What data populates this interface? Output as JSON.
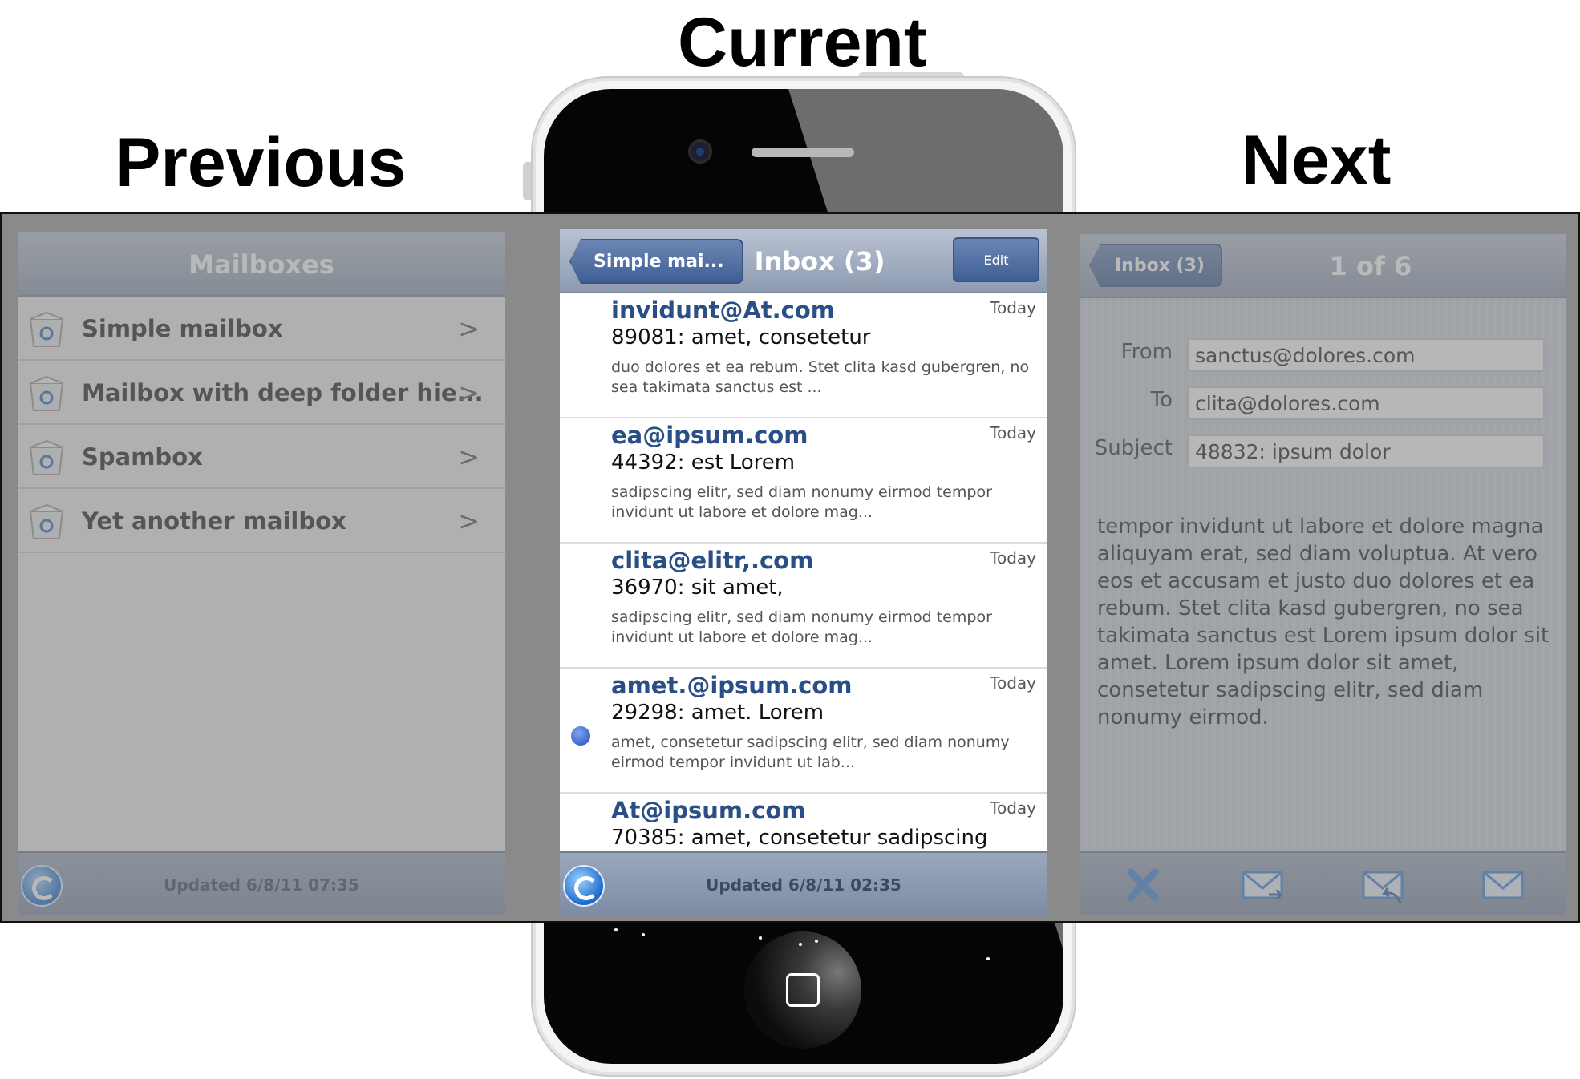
{
  "labels": {
    "current": "Current",
    "previous": "Previous",
    "next": "Next"
  },
  "previous": {
    "title": "Mailboxes",
    "items": [
      {
        "label": "Simple mailbox",
        "chevron": ">"
      },
      {
        "label": "Mailbox with deep folder hie...",
        "chevron": ">"
      },
      {
        "label": "Spambox",
        "chevron": ">"
      },
      {
        "label": "Yet another mailbox",
        "chevron": ">"
      }
    ],
    "updated": "Updated 6/8/11 07:35"
  },
  "current": {
    "back_label": "Simple mai...",
    "title": "Inbox (3)",
    "edit_label": "Edit",
    "messages": [
      {
        "from": "invidunt@At.com",
        "date": "Today",
        "subject": "89081: amet, consetetur",
        "preview": "duo dolores et ea rebum. Stet clita kasd gubergren, no sea takimata sanctus est ...",
        "unread": false
      },
      {
        "from": "ea@ipsum.com",
        "date": "Today",
        "subject": "44392: est Lorem",
        "preview": "sadipscing elitr, sed diam nonumy eirmod tempor invidunt ut labore et dolore mag...",
        "unread": false
      },
      {
        "from": "clita@elitr,.com",
        "date": "Today",
        "subject": "36970: sit amet,",
        "preview": "sadipscing elitr, sed diam nonumy eirmod tempor invidunt ut labore et dolore mag...",
        "unread": false
      },
      {
        "from": "amet.@ipsum.com",
        "date": "Today",
        "subject": "29298: amet. Lorem",
        "preview": "amet, consetetur sadipscing elitr, sed diam nonumy eirmod tempor invidunt ut lab...",
        "unread": true
      },
      {
        "from": "At@ipsum.com",
        "date": "Today",
        "subject": "70385: amet, consetetur sadipscing",
        "preview": "",
        "unread": true
      }
    ],
    "updated": "Updated 6/8/11 02:35"
  },
  "next": {
    "back_label": "Inbox (3)",
    "title": "1 of 6",
    "from_label": "From",
    "from_value": "sanctus@dolores.com",
    "to_label": "To",
    "to_value": "clita@dolores.com",
    "subject_label": "Subject",
    "subject_value": "48832: ipsum dolor",
    "body": "tempor invidunt ut labore et dolore magna aliquyam erat, sed diam voluptua. At vero eos et accusam et justo duo dolores et ea rebum. Stet clita kasd gubergren, no sea takimata sanctus est Lorem ipsum dolor sit amet. Lorem ipsum dolor sit amet, consetetur sadipscing elitr, sed diam nonumy eirmod.",
    "toolbar_icons": [
      "delete-icon",
      "forward-icon",
      "reply-icon",
      "compose-icon"
    ]
  },
  "colors": {
    "accent": "#2a4f86",
    "navbar": "#8d9ab0",
    "unread_dot": "#1d4db8"
  }
}
